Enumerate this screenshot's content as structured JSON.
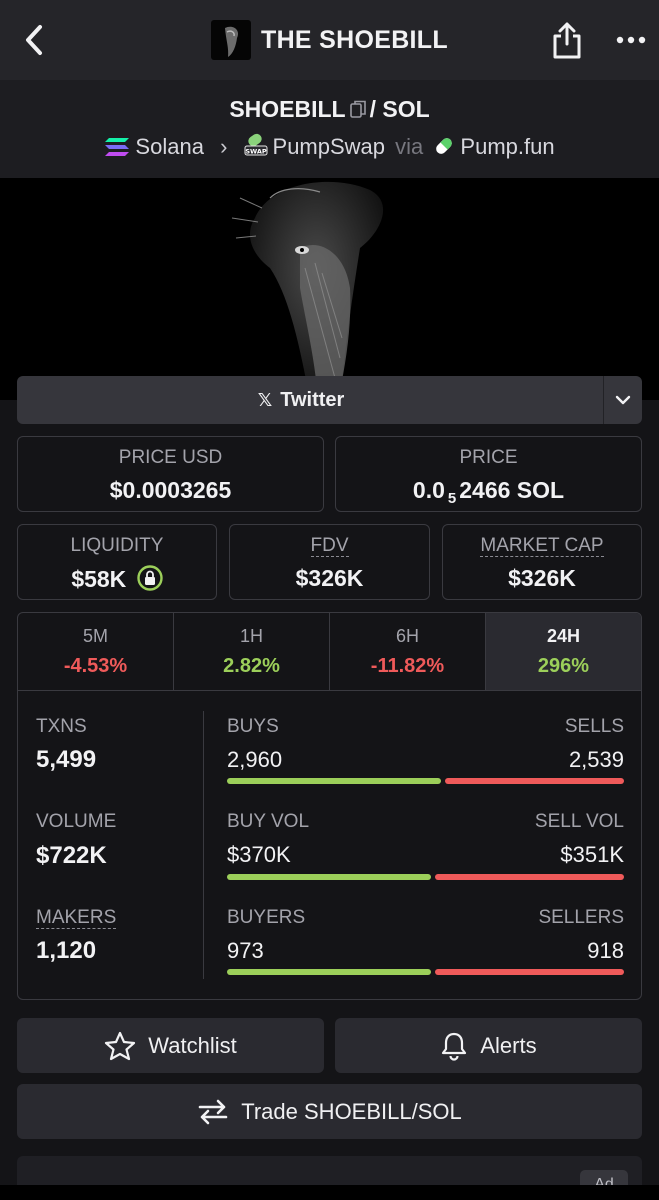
{
  "header": {
    "title": "THE SHOEBILL",
    "back_icon": "chevron-left-icon",
    "share_icon": "share-icon",
    "more_icon": "more-horizontal-icon"
  },
  "pair": {
    "base": "SHOEBILL",
    "separator": "/",
    "quote": "SOL",
    "chain": "Solana",
    "dex": "PumpSwap",
    "via": "via",
    "launchpad": "Pump.fun"
  },
  "socials": {
    "twitter_label": "Twitter"
  },
  "price": {
    "price_usd_label": "PRICE USD",
    "price_usd": "$0.0003265",
    "price_label": "PRICE",
    "price_sol_prefix": "0.0",
    "price_sol_zeros": "5",
    "price_sol_digits": "2466 SOL"
  },
  "metrics": {
    "liquidity_label": "LIQUIDITY",
    "liquidity": "$58K",
    "fdv_label": "FDV",
    "fdv": "$326K",
    "mcap_label": "MARKET CAP",
    "mcap": "$326K"
  },
  "timeframes": [
    {
      "label": "5M",
      "change": "-4.53%",
      "direction": "down"
    },
    {
      "label": "1H",
      "change": "2.82%",
      "direction": "up"
    },
    {
      "label": "6H",
      "change": "-11.82%",
      "direction": "down"
    },
    {
      "label": "24H",
      "change": "296%",
      "direction": "up",
      "active": true
    }
  ],
  "txns": {
    "txns_label": "TXNS",
    "txns": "5,499",
    "buys_label": "BUYS",
    "buys": "2,960",
    "sells_label": "SELLS",
    "sells": "2,539"
  },
  "volume": {
    "volume_label": "VOLUME",
    "volume": "$722K",
    "buy_vol_label": "BUY VOL",
    "buy_vol": "$370K",
    "sell_vol_label": "SELL VOL",
    "sell_vol": "$351K"
  },
  "makers": {
    "makers_label": "MAKERS",
    "makers": "1,120",
    "buyers_label": "BUYERS",
    "buyers": "973",
    "sellers_label": "SELLERS",
    "sellers": "918"
  },
  "actions": {
    "watchlist": "Watchlist",
    "alerts": "Alerts",
    "trade": "Trade SHOEBILL/SOL"
  },
  "ad": {
    "tag": "Ad"
  },
  "colors": {
    "positive": "#9ccf5a",
    "negative": "#ef5a5a",
    "background": "#141417"
  }
}
